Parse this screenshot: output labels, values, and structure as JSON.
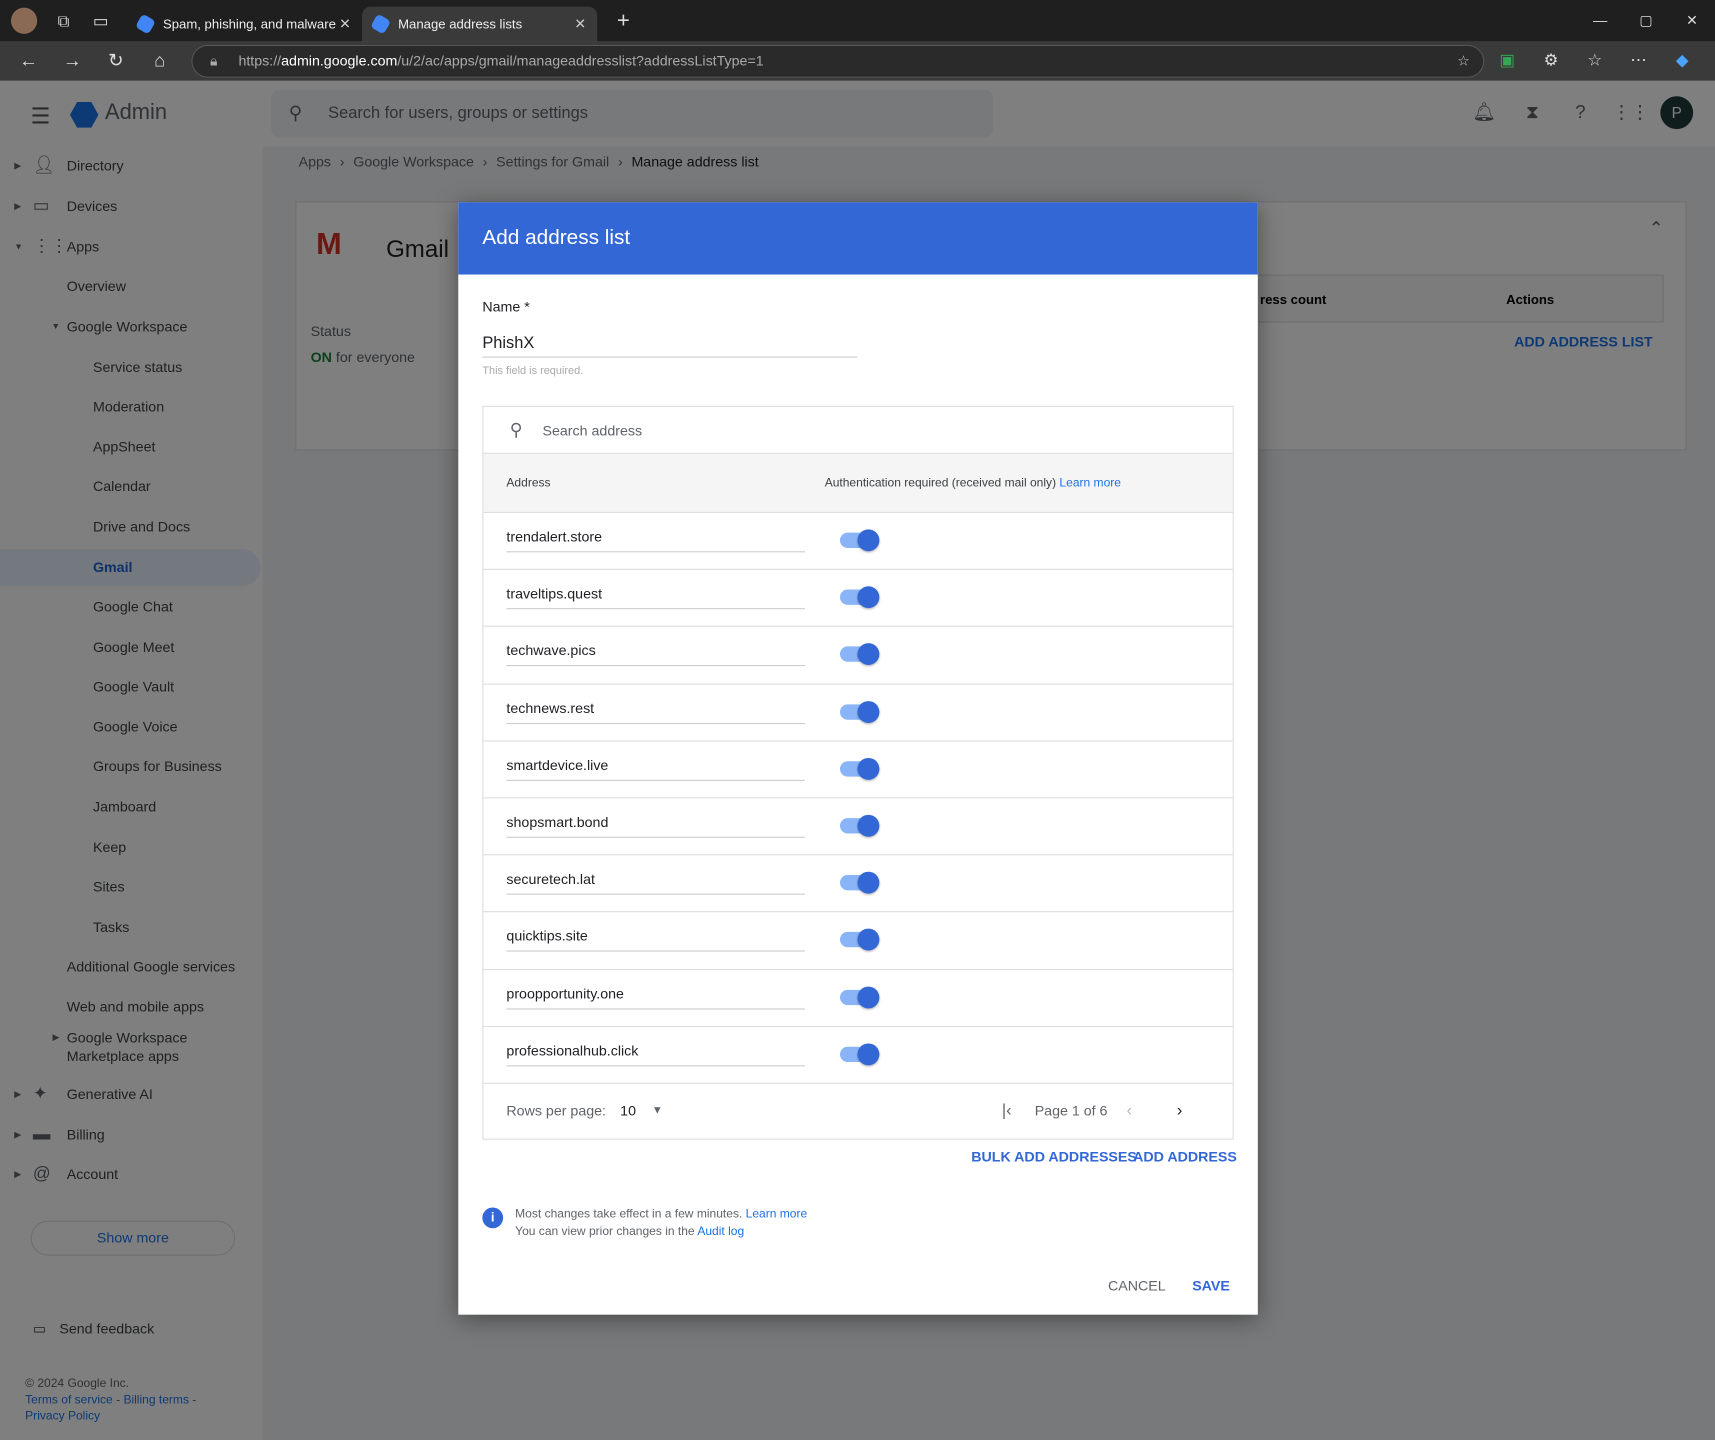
{
  "browser": {
    "tabs": [
      {
        "title": "Spam, phishing, and malware",
        "active": false
      },
      {
        "title": "Manage address lists",
        "active": true
      }
    ],
    "url_prefix": "https://",
    "url_host": "admin.google.com",
    "url_path": "/u/2/ac/apps/gmail/manageaddresslist?addressListType=1"
  },
  "header": {
    "app": "Admin",
    "search_placeholder": "Search for users, groups or settings",
    "avatar": "P"
  },
  "breadcrumb": [
    "Apps",
    "Google Workspace",
    "Settings for Gmail",
    "Manage address list"
  ],
  "sidebar": {
    "items": [
      {
        "label": "Directory",
        "icon": "person-icon"
      },
      {
        "label": "Devices",
        "icon": "devices-icon"
      },
      {
        "label": "Apps",
        "icon": "apps-grid-icon"
      },
      {
        "label": "Overview"
      },
      {
        "label": "Google Workspace"
      },
      {
        "label": "Service status"
      },
      {
        "label": "Moderation"
      },
      {
        "label": "AppSheet"
      },
      {
        "label": "Calendar"
      },
      {
        "label": "Drive and Docs"
      },
      {
        "label": "Gmail",
        "selected": true
      },
      {
        "label": "Google Chat"
      },
      {
        "label": "Google Meet"
      },
      {
        "label": "Google Vault"
      },
      {
        "label": "Google Voice"
      },
      {
        "label": "Groups for Business"
      },
      {
        "label": "Jamboard"
      },
      {
        "label": "Keep"
      },
      {
        "label": "Sites"
      },
      {
        "label": "Tasks"
      },
      {
        "label": "Additional Google services"
      },
      {
        "label": "Web and mobile apps"
      },
      {
        "label": "Google Workspace Marketplace apps"
      },
      {
        "label": "Generative AI",
        "icon": "sparkle-icon"
      },
      {
        "label": "Billing",
        "icon": "credit-card-icon"
      },
      {
        "label": "Account",
        "icon": "at-icon"
      }
    ],
    "show_more": "Show more",
    "send_feedback": "Send feedback",
    "copyright": "© 2024 Google Inc.",
    "terms": "Terms of service",
    "billing_terms": "Billing terms",
    "privacy": "Privacy Policy"
  },
  "background_card": {
    "title": "Gmail",
    "status_label": "Status",
    "status_on": "ON",
    "status_rest": " for everyone",
    "col_count": "ress count",
    "col_actions": "Actions",
    "add_list": "ADD ADDRESS LIST"
  },
  "modal": {
    "title": "Add address list",
    "name_label": "Name *",
    "name_value": "PhishX",
    "name_hint": "This field is required.",
    "search_placeholder": "Search address",
    "col_address": "Address",
    "col_auth": "Authentication required (received mail only)",
    "col_auth_link": "Learn more",
    "rows": [
      {
        "address": "trendalert.store",
        "auth": true
      },
      {
        "address": "traveltips.quest",
        "auth": true
      },
      {
        "address": "techwave.pics",
        "auth": true
      },
      {
        "address": "technews.rest",
        "auth": true
      },
      {
        "address": "smartdevice.live",
        "auth": true
      },
      {
        "address": "shopsmart.bond",
        "auth": true
      },
      {
        "address": "securetech.lat",
        "auth": true
      },
      {
        "address": "quicktips.site",
        "auth": true
      },
      {
        "address": "proopportunity.one",
        "auth": true
      },
      {
        "address": "professionalhub.click",
        "auth": true
      }
    ],
    "rows_per_page_label": "Rows per page:",
    "rows_per_page": "10",
    "page_text": "Page 1 of 6",
    "bulk_add": "BULK ADD ADDRESSES",
    "add_address": "ADD ADDRESS",
    "info_line1": "Most changes take effect in a few minutes. ",
    "info_link1": "Learn more",
    "info_line2": "You can view prior changes in the ",
    "info_link2": "Audit log",
    "cancel": "CANCEL",
    "save": "SAVE",
    "accent": "#3367d6"
  }
}
